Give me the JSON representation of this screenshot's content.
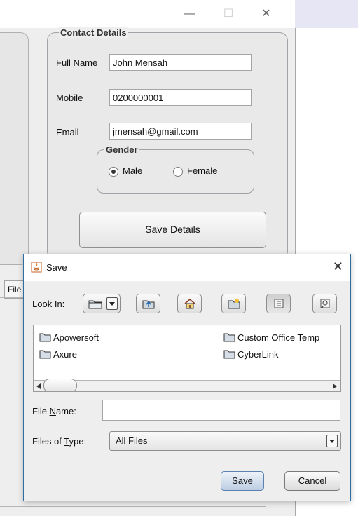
{
  "main_window": {
    "controls": {
      "minimize": "—",
      "maximize": "☐",
      "close": "✕"
    },
    "contact": {
      "title": "Contact Details",
      "full_name_label": "Full Name",
      "full_name_value": "John Mensah",
      "mobile_label": "Mobile",
      "mobile_value": "0200000001",
      "email_label": "Email",
      "email_value": "jmensah@gmail.com",
      "gender": {
        "title": "Gender",
        "male": "Male",
        "female": "Female",
        "selected": "Male"
      },
      "save_button": "Save Details"
    },
    "file_stub": "File"
  },
  "dialog": {
    "title": "Save",
    "close": "✕",
    "look_in_label_pre": "Look ",
    "look_in_label_key": "I",
    "look_in_label_post": "n:",
    "files": [
      "Apowersoft",
      "Custom Office Temp",
      "Axure",
      "CyberLink"
    ],
    "file_name_label_pre": "File ",
    "file_name_label_key": "N",
    "file_name_label_post": "ame:",
    "file_name_value": "",
    "files_of_type_label_pre": "Files of ",
    "files_of_type_label_key": "T",
    "files_of_type_label_post": "ype:",
    "files_of_type_value": "All Files",
    "save_button": "Save",
    "cancel_button": "Cancel"
  },
  "icons": [
    "minimize-icon",
    "maximize-icon",
    "close-icon",
    "java-icon",
    "folder-icon",
    "up-folder-icon",
    "home-icon",
    "new-folder-icon",
    "list-view-icon",
    "details-view-icon"
  ]
}
